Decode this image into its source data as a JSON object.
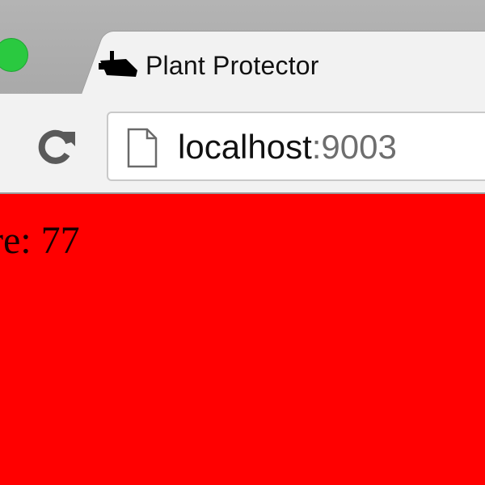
{
  "tab": {
    "title": "Plant Protector",
    "favicon": "security-camera-icon"
  },
  "toolbar": {
    "reload_icon": "reload-icon",
    "page_icon": "page-icon"
  },
  "address_bar": {
    "host": "localhost",
    "port": ":9003"
  },
  "page": {
    "background_color": "#ff0000",
    "visible_text": "re: 77"
  },
  "colors": {
    "traffic_light_green": "#2ac940",
    "chrome_gray": "#f2f2f2"
  }
}
